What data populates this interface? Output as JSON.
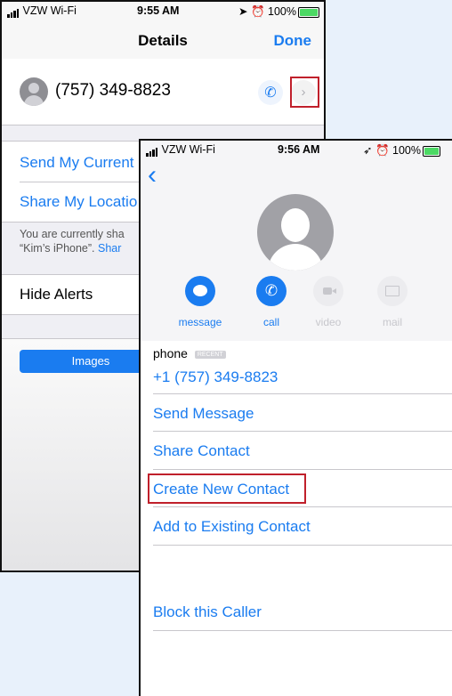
{
  "back_screen": {
    "status": {
      "carrier": "VZW Wi-Fi",
      "time": "9:55 AM",
      "battery": "100%"
    },
    "nav": {
      "title": "Details",
      "done": "Done"
    },
    "contact": {
      "number": "(757) 349-8823"
    },
    "send_location": "Send My Current",
    "share_location": "Share My Locatio",
    "info_line1": "You are currently sha",
    "info_line2_prefix": "“Kim’s iPhone”. ",
    "info_line2_link": "Shar",
    "hide_alerts": "Hide Alerts",
    "images_tab": "Images"
  },
  "front_screen": {
    "status": {
      "carrier": "VZW Wi-Fi",
      "time": "9:56 AM",
      "battery": "100%"
    },
    "actions": [
      {
        "label": "message",
        "enabled": true
      },
      {
        "label": "call",
        "enabled": true
      },
      {
        "label": "video",
        "enabled": false
      },
      {
        "label": "mail",
        "enabled": false
      }
    ],
    "phone_label": "phone",
    "recent_badge": "RECENT",
    "phone_number": "+1 (757) 349-8823",
    "menu": [
      {
        "label": "Send Message"
      },
      {
        "label": "Share Contact"
      },
      {
        "label": "Create New Contact"
      },
      {
        "label": "Add to Existing Contact"
      }
    ],
    "block": "Block this Caller"
  },
  "colors": {
    "accent": "#1a7cf0",
    "highlight": "#c0202b",
    "battery": "#4cd964"
  }
}
